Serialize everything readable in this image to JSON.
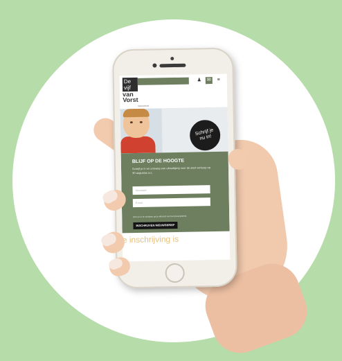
{
  "colors": {
    "background": "#b6dca9",
    "accent_green": "#6e7f60",
    "badge_black": "#1c1c1c",
    "heading_gold": "#e6c07b"
  },
  "site": {
    "logo_line1": "De",
    "logo_line2": "vijf",
    "logo_line3": "van",
    "logo_line4": "Vorst",
    "logo_sub": "basisschool",
    "icons": [
      "user-icon",
      "mail-icon",
      "menu-icon"
    ],
    "icon_glyphs": {
      "user": "♟",
      "mail": "✉",
      "menu": "≡"
    }
  },
  "hero": {
    "badge_text": "Schrijf je nu in!"
  },
  "newsletter": {
    "title": "BLIJF OP DE HOOGTE",
    "text": "Schrijf je in en ontvang een uitnodiging voor de start verkoop op 30 augustus a.s.",
    "name_placeholder": "Voornaam",
    "email_placeholder": "E-mail",
    "consent": "Door je in te schrijven ga je akkoord met het privacybeleid.",
    "button_label": "INSCHRIJVEN NIEUWSBRIEF"
  },
  "content": {
    "heading": "e inschrijving is"
  }
}
